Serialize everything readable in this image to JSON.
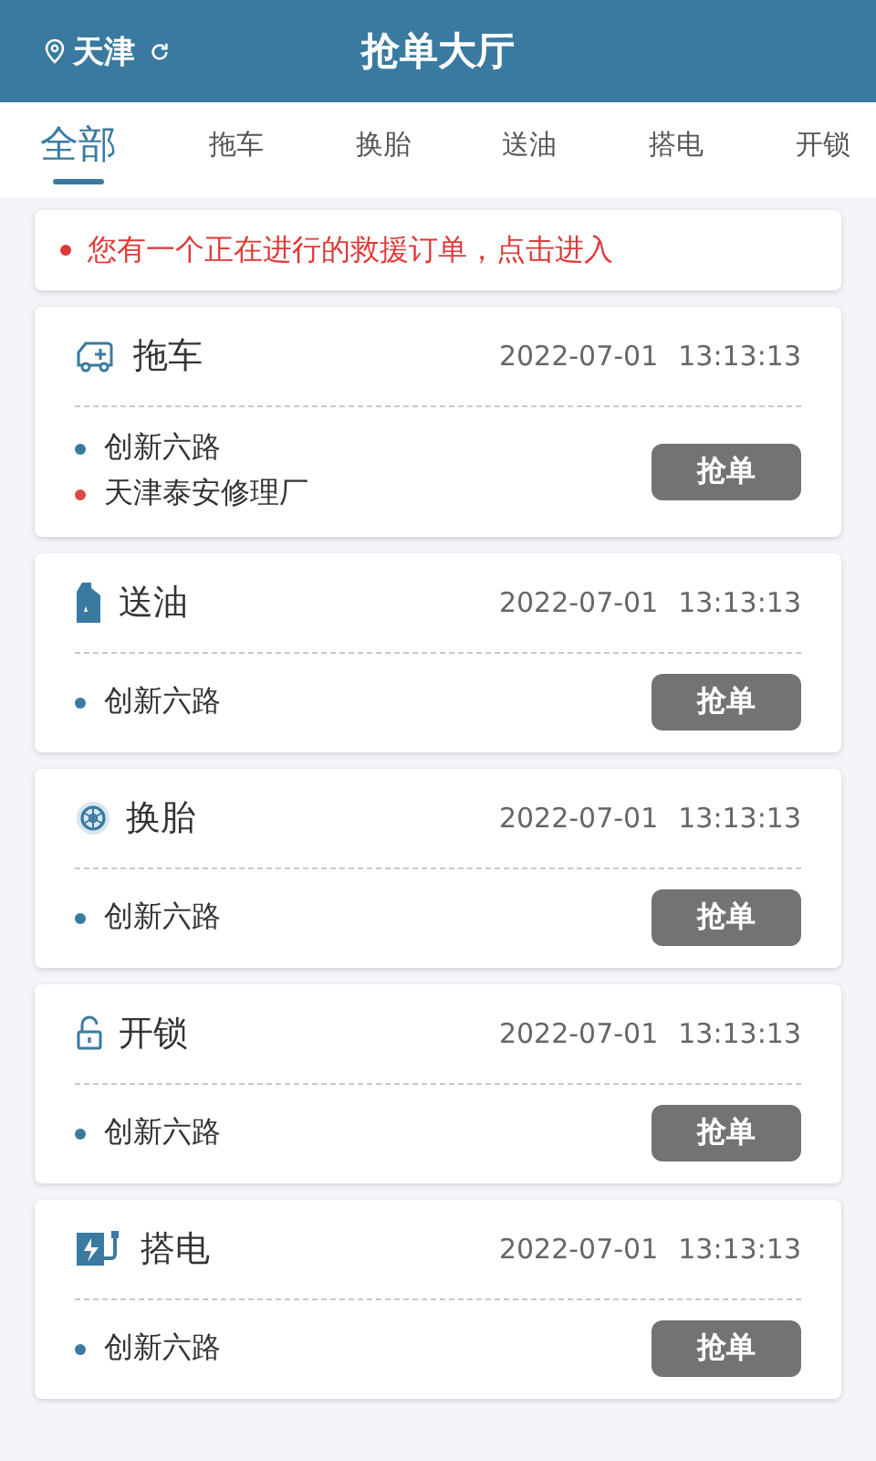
{
  "header": {
    "city": "天津",
    "title": "抢单大厅"
  },
  "tabs": [
    {
      "label": "全部",
      "selected": true
    },
    {
      "label": "拖车",
      "selected": false
    },
    {
      "label": "换胎",
      "selected": false
    },
    {
      "label": "送油",
      "selected": false
    },
    {
      "label": "搭电",
      "selected": false
    },
    {
      "label": "开锁",
      "selected": false
    }
  ],
  "notice": "您有一个正在进行的救援订单，点击进入",
  "orders": [
    {
      "kind": "tow",
      "type": "拖车",
      "date": "2022-07-01",
      "time": "13:13:13",
      "places": [
        {
          "name": "创新六路",
          "color": "#3a7aa0"
        },
        {
          "name": "天津泰安修理厂",
          "color": "#e04848"
        }
      ],
      "button": "抢单"
    },
    {
      "kind": "fuel",
      "type": "送油",
      "date": "2022-07-01",
      "time": "13:13:13",
      "places": [
        {
          "name": "创新六路",
          "color": "#3a7aa0"
        }
      ],
      "button": "抢单"
    },
    {
      "kind": "tire",
      "type": "换胎",
      "date": "2022-07-01",
      "time": "13:13:13",
      "places": [
        {
          "name": "创新六路",
          "color": "#3a7aa0"
        }
      ],
      "button": "抢单"
    },
    {
      "kind": "lock",
      "type": "开锁",
      "date": "2022-07-01",
      "time": "13:13:13",
      "places": [
        {
          "name": "创新六路",
          "color": "#3a7aa0"
        }
      ],
      "button": "抢单"
    },
    {
      "kind": "charge",
      "type": "搭电",
      "date": "2022-07-01",
      "time": "13:13:13",
      "places": [
        {
          "name": "创新六路",
          "color": "#3a7aa0"
        }
      ],
      "button": "抢单"
    }
  ]
}
